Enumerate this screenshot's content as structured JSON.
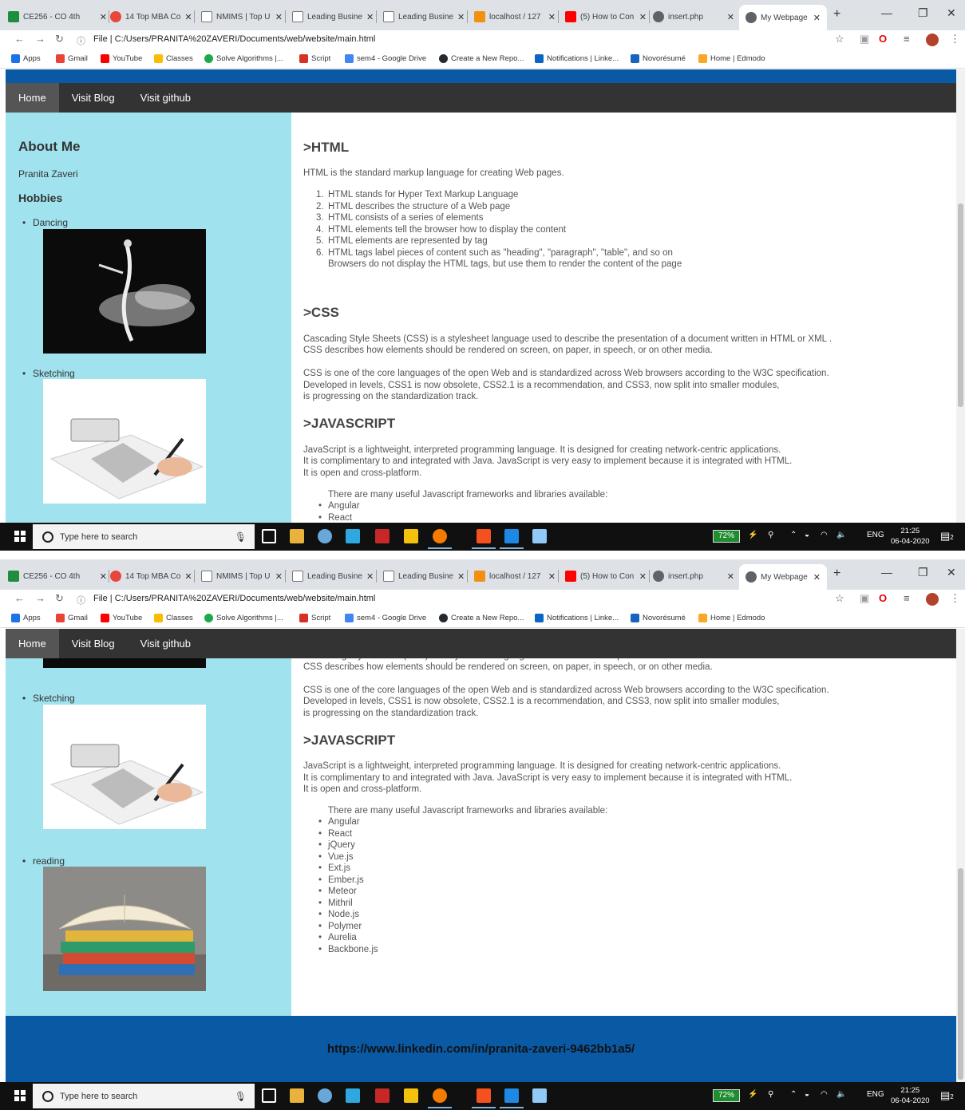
{
  "browser": {
    "tabs": [
      {
        "title": "CE256 - CO 4th",
        "color": "#1e8e3e"
      },
      {
        "title": "14 Top MBA Co",
        "color": "#e8453c"
      },
      {
        "title": "NMIMS | Top U",
        "color": "#5f6368"
      },
      {
        "title": "Leading Busine",
        "color": "#5f6368"
      },
      {
        "title": "Leading Busine",
        "color": "#5f6368"
      },
      {
        "title": "localhost / 127",
        "color": "#f29111"
      },
      {
        "title": "(5) How to Con",
        "color": "#ff0000"
      },
      {
        "title": "insert.php",
        "color": "#5f6368"
      }
    ],
    "active_tab": "My Webpage",
    "address_label": "File",
    "address_url": "C:/Users/PRANITA%20ZAVERI/Documents/web/website/main.html",
    "bookmarks": [
      {
        "label": "Apps",
        "color": "#1a73e8"
      },
      {
        "label": "Gmail",
        "color": "#ea4335"
      },
      {
        "label": "YouTube",
        "color": "#ff0000"
      },
      {
        "label": "Classes",
        "color": "#fbbc04"
      },
      {
        "label": "Solve Algorithms |...",
        "color": "#1ba94c"
      },
      {
        "label": "Script",
        "color": "#d93025"
      },
      {
        "label": "sem4 - Google Drive",
        "color": "#4285f4"
      },
      {
        "label": "Create a New Repo...",
        "color": "#24292e"
      },
      {
        "label": "Notifications | Linke...",
        "color": "#0a66c2"
      },
      {
        "label": "Novorésumé",
        "color": "#1565c0"
      },
      {
        "label": "Home | Edmodo",
        "color": "#f9a825"
      }
    ]
  },
  "page": {
    "nav": [
      "Home",
      "Visit Blog",
      "Visit github"
    ],
    "about_title": "About Me",
    "name": "Pranita Zaveri",
    "hobbies_title": "Hobbies",
    "hobbies": [
      "Dancing",
      "Sketching",
      "reading"
    ],
    "html_title": ">HTML",
    "html_intro": "HTML is the standard markup language for creating Web pages.",
    "html_list": [
      "HTML stands for Hyper Text Markup Language",
      "HTML describes the structure of a Web page",
      "HTML consists of a series of elements",
      "HTML elements tell the browser how to display the content",
      "HTML elements are represented by tag",
      "HTML tags label pieces of content such as \"heading\", \"paragraph\", \"table\", and so on"
    ],
    "html_note": "Browsers do not display the HTML tags, but use them to render the content of the page",
    "css_title": ">CSS",
    "css_p1_l1": "Cascading Style Sheets (CSS) is a stylesheet language used to describe the presentation of a document written in HTML or XML .",
    "css_p1_l2": "CSS describes how elements should be rendered on screen, on paper, in speech, or on other media.",
    "css_p2_l1": "CSS is one of the core languages of the open Web and is standardized across Web browsers according to the W3C specification.",
    "css_p2_l2": "Developed in levels, CSS1 is now obsolete, CSS2.1 is a recommendation, and CSS3, now split into smaller modules,",
    "css_p2_l3": "is progressing on the standardization track.",
    "js_title": ">JAVASCRIPT",
    "js_l1": "JavaScript is a lightweight, interpreted programming language. It is designed for creating network-centric applications.",
    "js_l2": "It is complimentary to and integrated with Java. JavaScript is very easy to implement because it is integrated with HTML.",
    "js_l3": "It is open and cross-platform.",
    "js_frameworks_intro": "There are many useful Javascript frameworks and libraries available:",
    "js_frameworks": [
      "Angular",
      "React",
      "jQuery",
      "Vue.js",
      "Ext.js",
      "Ember.js",
      "Meteor",
      "Mithril",
      "Node.js",
      "Polymer",
      "Aurelia",
      "Backbone.js"
    ],
    "footer_link": "https://www.linkedin.com/in/pranita-zaveri-9462bb1a5/"
  },
  "taskbar": {
    "search_placeholder": "Type here to search",
    "battery": "72%",
    "language": "ENG",
    "time": "21:25",
    "date": "06-04-2020",
    "notifications": "2"
  },
  "colors": {
    "top_bar": "#0a59a4",
    "navbar": "#333333",
    "sidebar": "#a0e2ee",
    "footer": "#0a59a4"
  }
}
